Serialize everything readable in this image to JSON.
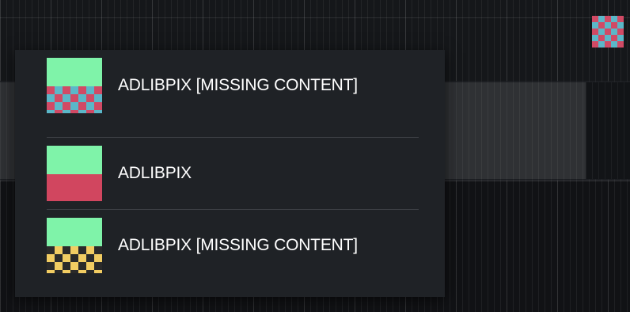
{
  "menu": {
    "items": [
      {
        "label": "ADLIBPIX [MISSING CONTENT]",
        "thumbnail": "missing-content-pink-blue-checker"
      },
      {
        "label": "ADLIBPIX",
        "thumbnail": "green-pink-solid"
      },
      {
        "label": "ADLIBPIX [MISSING CONTENT]",
        "thumbnail": "missing-content-yellow-checker"
      }
    ]
  },
  "colors": {
    "menu_bg": "#1f2226",
    "thumb_green": "#7ff3a9",
    "thumb_pink": "#d1465f",
    "thumb_blue": "#5bb7c8",
    "thumb_yellow": "#f1cc62"
  }
}
